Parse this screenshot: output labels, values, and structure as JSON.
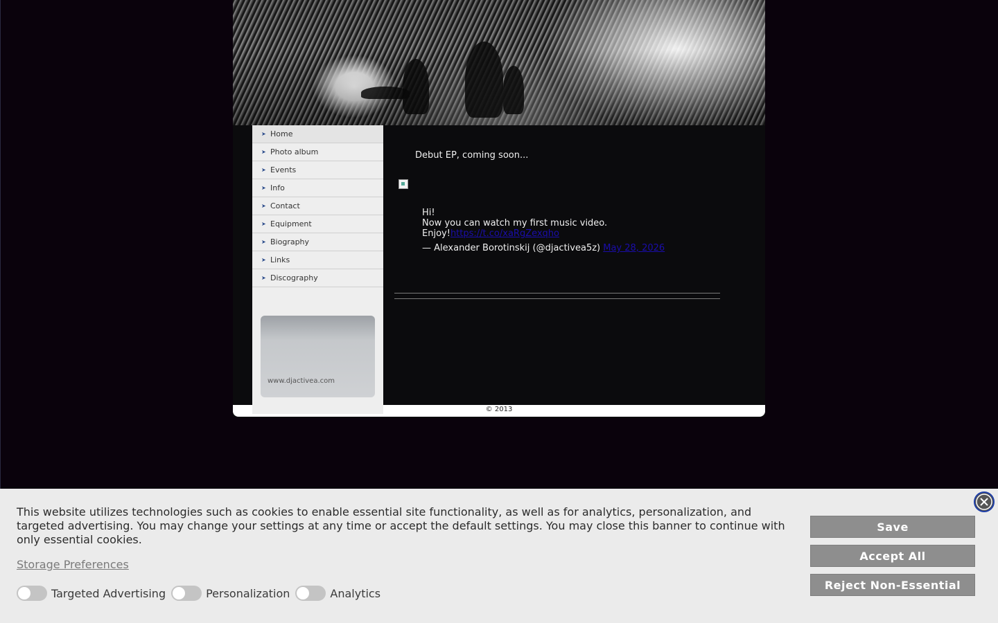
{
  "nav": {
    "items": [
      {
        "label": "Home"
      },
      {
        "label": "Photo album"
      },
      {
        "label": "Events"
      },
      {
        "label": "Info"
      },
      {
        "label": "Contact"
      },
      {
        "label": "Equipment"
      },
      {
        "label": "Biography"
      },
      {
        "label": "Links"
      },
      {
        "label": "Discography"
      }
    ],
    "arrow_icon": "chevron-right-icon"
  },
  "promo": {
    "url_text": "www.djactivea.com"
  },
  "content": {
    "headline": "Debut EP, coming soon...",
    "tweet": {
      "line1": "Hi!",
      "line2": "Now you can watch my first music video.",
      "line3_prefix": "Enjoy!",
      "link": "https://t.co/xaRgZexqho",
      "attribution": "— Alexander Borotinskij (@djactivea5z)",
      "date": "May 28, 2026"
    }
  },
  "footer": {
    "copyright": "© 2013"
  },
  "cookie_banner": {
    "text": "This website utilizes technologies such as cookies to enable essential site functionality, as well as for analytics, personalization, and targeted advertising. You may change your settings at any time or accept the default settings. You may close this banner to continue with only essential cookies.",
    "storage_link": "Storage Preferences",
    "toggles": [
      {
        "label": "Targeted Advertising",
        "on": false
      },
      {
        "label": "Personalization",
        "on": false
      },
      {
        "label": "Analytics",
        "on": false
      }
    ],
    "buttons": {
      "save": "Save",
      "accept_all": "Accept All",
      "reject": "Reject Non-Essential"
    },
    "close_icon": "close-icon"
  },
  "colors": {
    "page_bg": "#0a020c",
    "button_bg": "#8e8e8e",
    "link_blue": "#1a0dab"
  }
}
